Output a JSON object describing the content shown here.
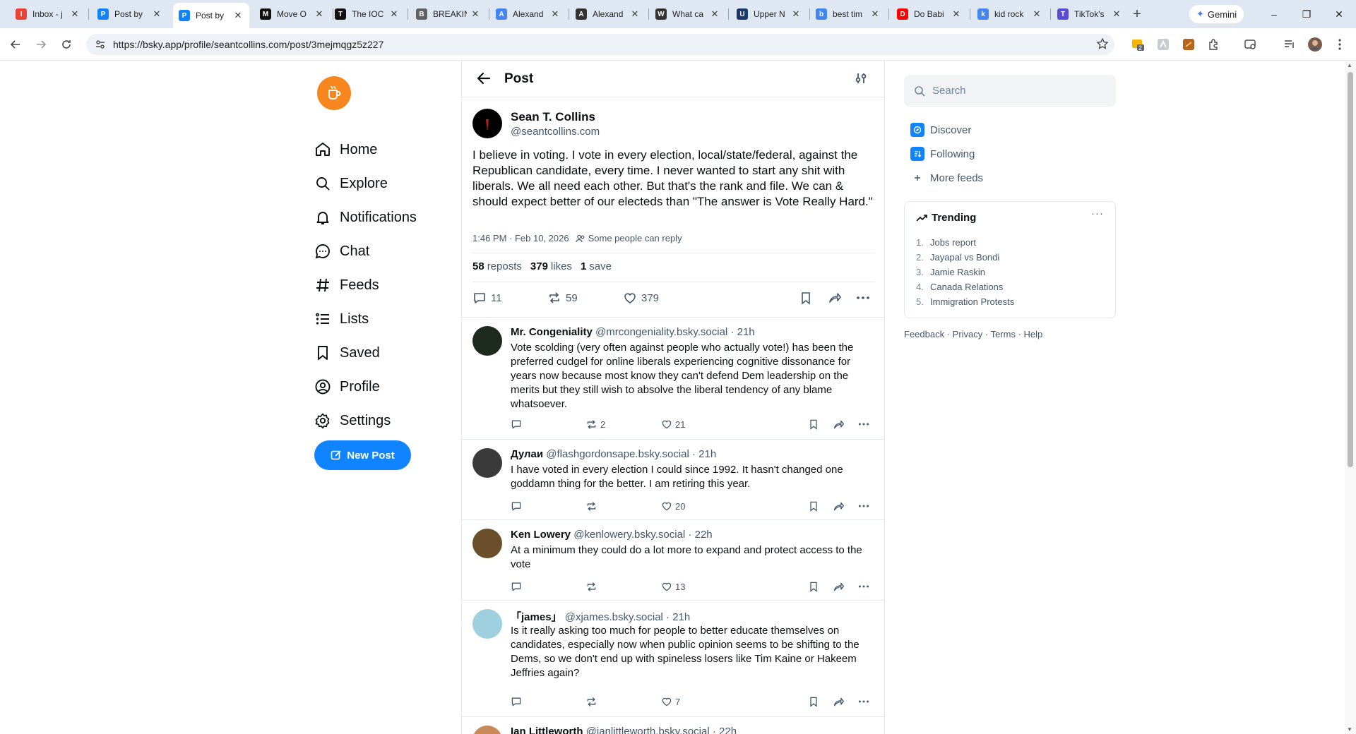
{
  "browser": {
    "tabs": [
      {
        "label": "Inbox - j",
        "favicon": "gmail-icon",
        "color": "#ea4335"
      },
      {
        "label": "Post by",
        "favicon": "bluesky-icon",
        "color": "#1083fe"
      },
      {
        "label": "Post by",
        "favicon": "bluesky-icon",
        "color": "#1083fe",
        "active": true
      },
      {
        "label": "Move O",
        "favicon": "nyt-icon",
        "color": "#111111"
      },
      {
        "label": "The IOC",
        "favicon": "atlantic-icon",
        "color": "#111111"
      },
      {
        "label": "BREAKIN",
        "favicon": "globe-icon",
        "color": "#5f6368"
      },
      {
        "label": "Alexand",
        "favicon": "google-icon",
        "color": "#4285f4"
      },
      {
        "label": "Alexand",
        "favicon": "wikipedia-icon",
        "color": "#333333"
      },
      {
        "label": "What ca",
        "favicon": "wordpress-icon",
        "color": "#333333"
      },
      {
        "label": "Upper N",
        "favicon": "site-icon",
        "color": "#1a3a6b"
      },
      {
        "label": "best tim",
        "favicon": "google-icon",
        "color": "#4285f4"
      },
      {
        "label": "Do Babi",
        "favicon": "youtube-icon",
        "color": "#ff0000"
      },
      {
        "label": "kid rock",
        "favicon": "google-icon",
        "color": "#4285f4"
      },
      {
        "label": "TikTok's",
        "favicon": "site-icon",
        "color": "#5b4bd6"
      }
    ],
    "gemini_label": "Gemini",
    "url": "https://bsky.app/profile/seantcollins.com/post/3mejmqgz5z227",
    "extension_badge": "2"
  },
  "nav": {
    "items": [
      {
        "label": "Home",
        "icon": "home-icon"
      },
      {
        "label": "Explore",
        "icon": "search-icon"
      },
      {
        "label": "Notifications",
        "icon": "bell-icon"
      },
      {
        "label": "Chat",
        "icon": "chat-icon"
      },
      {
        "label": "Feeds",
        "icon": "hash-icon"
      },
      {
        "label": "Lists",
        "icon": "list-icon"
      },
      {
        "label": "Saved",
        "icon": "bookmark-icon"
      },
      {
        "label": "Profile",
        "icon": "profile-icon"
      },
      {
        "label": "Settings",
        "icon": "gear-icon"
      }
    ],
    "new_post": "New Post"
  },
  "header": {
    "title": "Post"
  },
  "post": {
    "author_name": "Sean T. Collins",
    "author_handle": "@seantcollins.com",
    "text": "I believe in voting. I vote in every election, local/state/federal, against the Republican candidate, every time. I never wanted to start any shit with liberals. We all need each other. But that's the rank and file. We can & should expect better of our electeds than \"The answer is Vote Really Hard.\"",
    "timestamp": "1:46 PM · Feb 10, 2026",
    "reply_permission": "Some people can reply",
    "stats": {
      "reposts_count": "58",
      "reposts_label": "reposts",
      "likes_count": "379",
      "likes_label": "likes",
      "saves_count": "1",
      "saves_label": "save"
    },
    "actions": {
      "replies": "11",
      "reposts": "59",
      "likes": "379"
    }
  },
  "replies": [
    {
      "name": "Mr. Congeniality",
      "handle": "@mrcongeniality.bsky.social",
      "age": "· 21h",
      "text": "Vote scolding (very often against people who actually vote!) has been the preferred cudgel for online liberals experiencing cognitive dissonance for years now because most know they can't defend Dem leadership on the merits but they still wish to absolve the liberal tendency of any blame whatsoever.",
      "reposts": "2",
      "likes": "21"
    },
    {
      "name": "Дулаи",
      "handle": "@flashgordonsape.bsky.social",
      "age": "· 21h",
      "text": "I have voted in every election I could since 1992. It hasn't changed one goddamn thing for the better. I am retiring this year.",
      "reposts": "",
      "likes": "20"
    },
    {
      "name": "Ken Lowery",
      "handle": "@kenlowery.bsky.social",
      "age": "· 22h",
      "text": "At a minimum they could do a lot more to expand and protect access to the vote",
      "reposts": "",
      "likes": "13"
    },
    {
      "name": "「james」",
      "handle": "@xjames.bsky.social",
      "age": "· 21h",
      "text": "Is it really asking too much for people to better educate themselves on candidates, especially now when public opinion seems to be shifting to the Dems, so we don't end up with spineless losers like Tim Kaine or Hakeem Jeffries again?",
      "reposts": "",
      "likes": "7"
    },
    {
      "name": "Ian Littleworth",
      "handle": "@ianlittleworth.bsky.social",
      "age": "· 22h",
      "text": "",
      "reposts": "",
      "likes": ""
    }
  ],
  "right": {
    "search_placeholder": "Search",
    "feeds": [
      {
        "label": "Discover",
        "icon": "discover-icon"
      },
      {
        "label": "Following",
        "icon": "following-icon"
      },
      {
        "label": "More feeds",
        "icon": "plus-icon"
      }
    ],
    "trending_title": "Trending",
    "trending": [
      "Jobs report",
      "Jayapal vs Bondi",
      "Jamie Raskin",
      "Canada Relations",
      "Immigration Protests"
    ],
    "footer": "Feedback · Privacy · Terms · Help"
  },
  "colors": {
    "accent": "#1083fe",
    "logo": "#f7861f",
    "muted": "#42576c"
  }
}
